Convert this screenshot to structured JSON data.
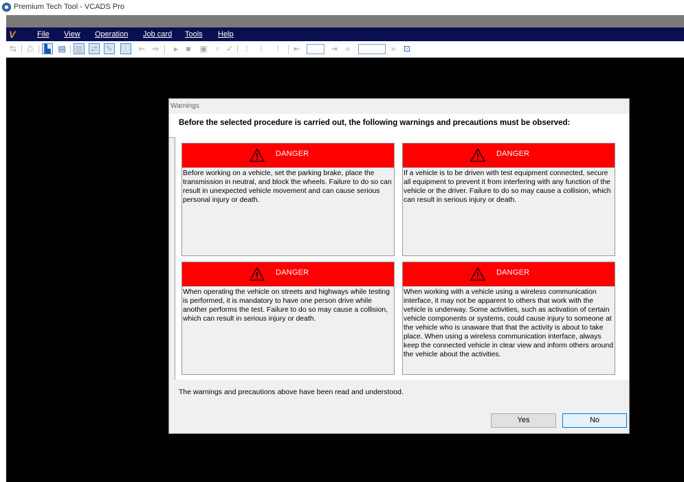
{
  "window": {
    "title": "Premium Tech Tool - VCADS Pro"
  },
  "menubar": {
    "logo": "V",
    "items": [
      {
        "label": "File"
      },
      {
        "label": "View"
      },
      {
        "label": "Operation"
      },
      {
        "label": "Job card"
      },
      {
        "label": "Tools"
      },
      {
        "label": "Help"
      }
    ]
  },
  "toolbar": {
    "icons": [
      "connect-icon",
      "print-icon",
      "tree-icon",
      "card-icon",
      "chart-icon",
      "swap-icon",
      "pen-icon",
      "info-icon",
      "back-icon",
      "forward-icon",
      "play-icon",
      "stop-icon",
      "document-icon",
      "balloon-icon",
      "check-icon",
      "step-start-icon",
      "step-pause-icon",
      "step-stop-icon",
      "first-icon",
      "next-icon",
      "prev-icon",
      "last-icon",
      "export-icon"
    ]
  },
  "dialog": {
    "title": "Warnings",
    "header": "Before the selected procedure is carried out, the following warnings and precautions must be observed:",
    "warnings": [
      {
        "label": "DANGER",
        "text": "Before working on a vehicle, set the parking brake, place the transmission in neutral, and block the wheels. Failure to do so can result in unexpected vehicle movement and can cause serious personal injury or death."
      },
      {
        "label": "DANGER",
        "text": "If a vehicle is to be driven with test equipment connected, secure all equipment to prevent it from interfering with any function of the vehicle or the driver. Failure to do so may cause a collision, which can result in serious injury or death."
      },
      {
        "label": "DANGER",
        "text": "When operating the vehicle on streets and highways while testing is performed, it is mandatory to have one person drive while another performs the test. Failure to do so may cause a collision, which can result in serious injury or death."
      },
      {
        "label": "DANGER",
        "text": "When working with a vehicle using a wireless communication interface, it may not be apparent to others that work with the vehicle is underway. Some activities, such as activation of certain vehicle components or systems, could cause injury to someone at the vehicle who is unaware that that the activity is about to take place. When using a wireless communication interface, always keep the connected vehicle in clear view and inform others around the vehicle about the activities."
      }
    ],
    "acknowledgement": "The warnings and precautions above have been read and understood.",
    "yes_label": "Yes",
    "no_label": "No"
  },
  "colors": {
    "danger": "#ff0000",
    "menubar": "#0a0f52",
    "background": "#000000"
  }
}
